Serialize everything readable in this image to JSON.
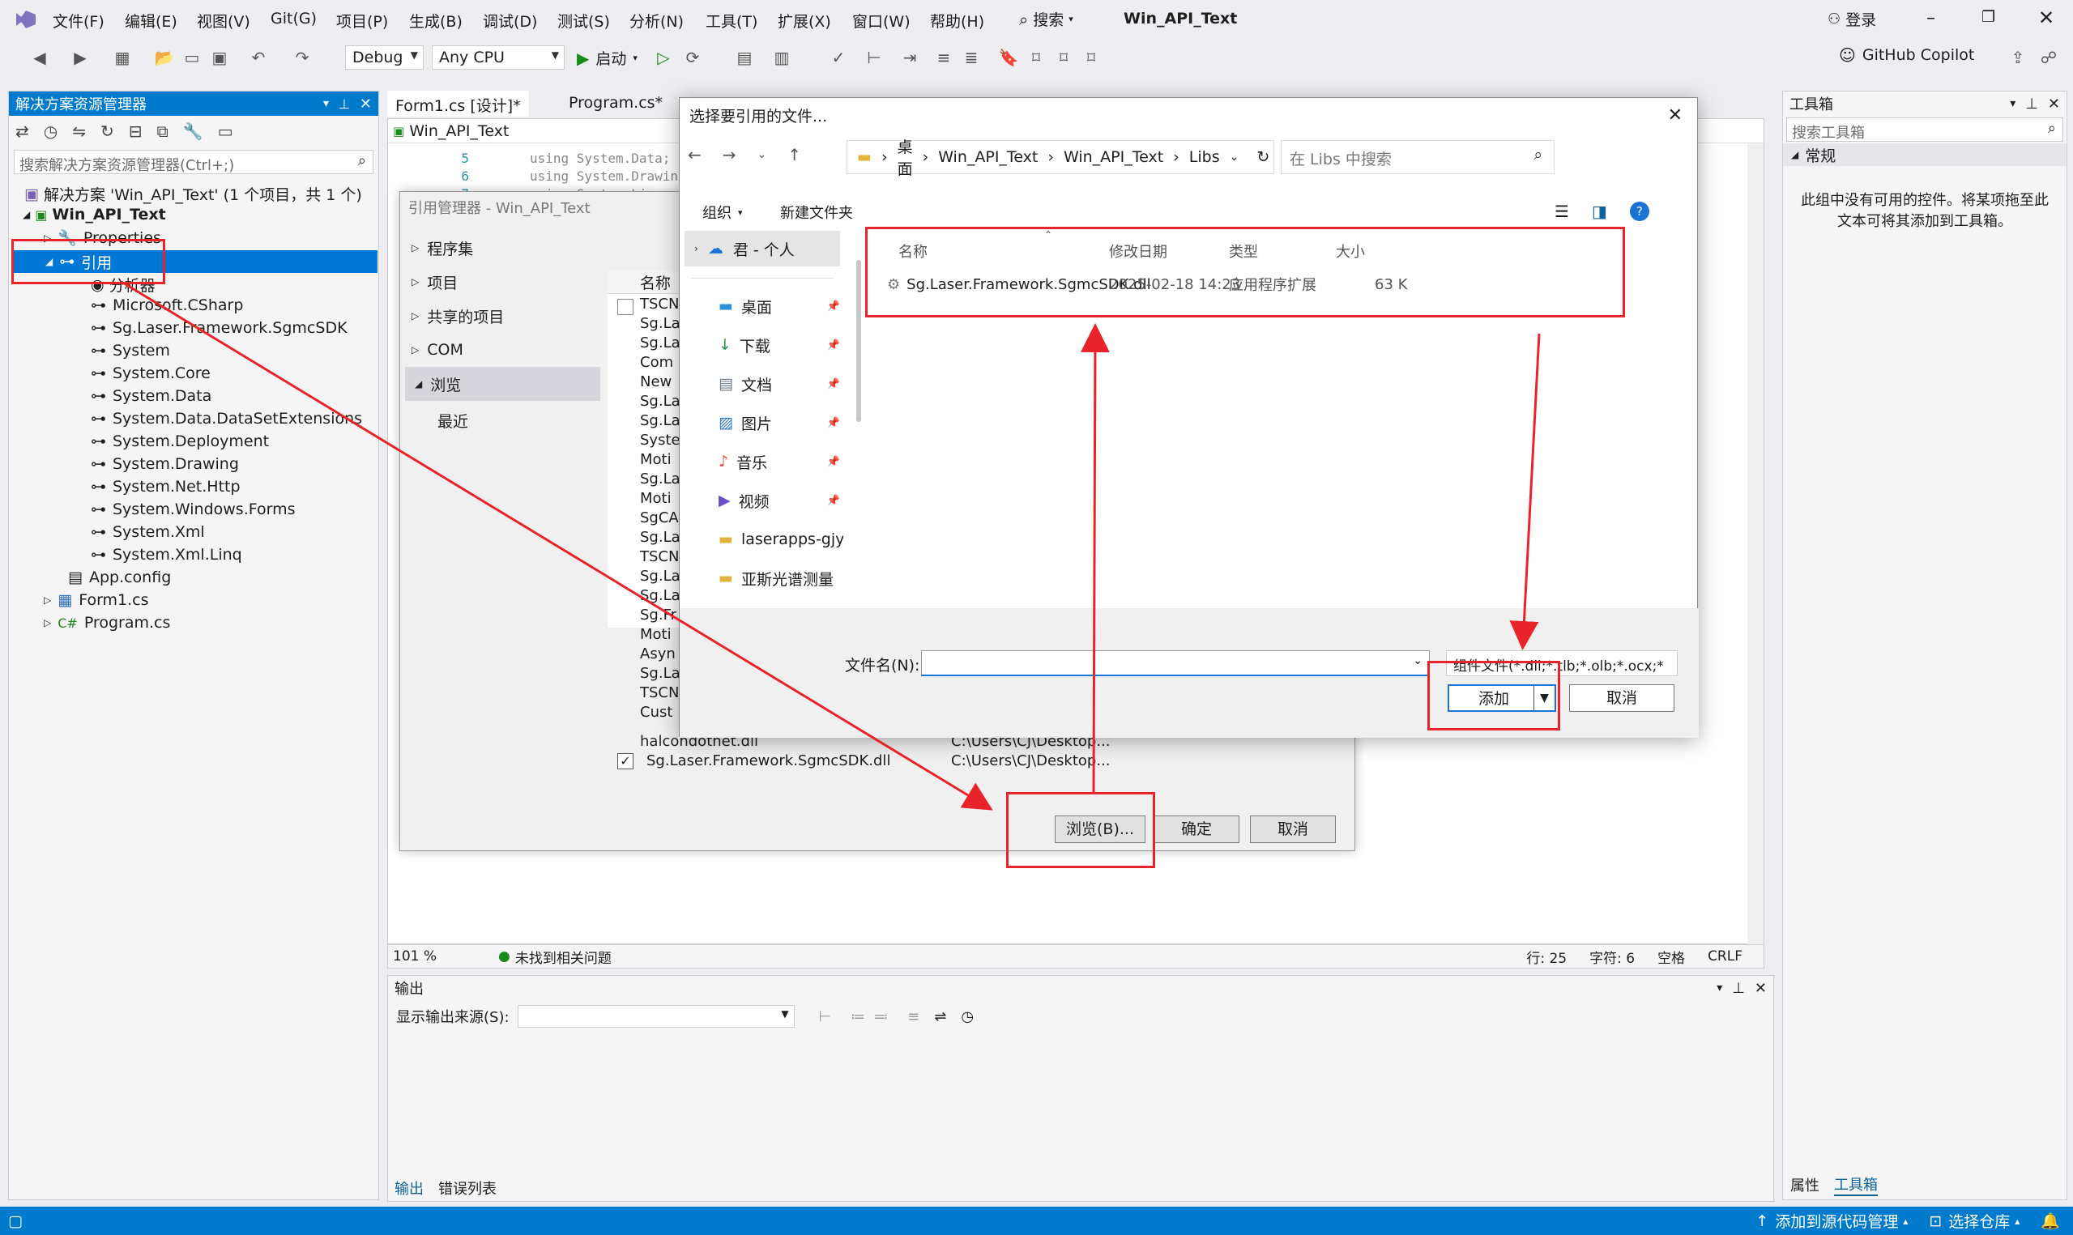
{
  "menubar": {
    "items": [
      "文件(F)",
      "编辑(E)",
      "视图(V)",
      "Git(G)",
      "项目(P)",
      "生成(B)",
      "调试(D)",
      "测试(S)",
      "分析(N)",
      "工具(T)",
      "扩展(X)",
      "窗口(W)",
      "帮助(H)"
    ],
    "search": "搜索",
    "solution_name": "Win_API_Text",
    "login": "登录",
    "copilot": "GitHub Copilot"
  },
  "toolbar": {
    "config": "Debug",
    "platform": "Any CPU",
    "start": "启动"
  },
  "solution_explorer": {
    "title": "解决方案资源管理器",
    "search_placeholder": "搜索解决方案资源管理器(Ctrl+;)",
    "solution": "解决方案 'Win_API_Text' (1 个项目，共 1 个)",
    "project": "Win_API_Text",
    "properties": "Properties",
    "references": "引用",
    "analyzers": "分析器",
    "refs": [
      "Microsoft.CSharp",
      "Sg.Laser.Framework.SgmcSDK",
      "System",
      "System.Core",
      "System.Data",
      "System.Data.DataSetExtensions",
      "System.Deployment",
      "System.Drawing",
      "System.Net.Http",
      "System.Windows.Forms",
      "System.Xml",
      "System.Xml.Linq"
    ],
    "app_config": "App.config",
    "form1": "Form1.cs",
    "program": "Program.cs"
  },
  "editor": {
    "tabs": [
      "Form1.cs [设计]*",
      "Program.cs*"
    ],
    "nav_combo": "Win_API_Text",
    "line_numbers": [
      "5",
      "6",
      "7"
    ],
    "code_lines": [
      "using System.Data;",
      "using System.Drawin",
      "using System.Linq;"
    ],
    "zoom": "101 %",
    "issues": "未找到相关问题",
    "line": "行: 25",
    "col": "字符: 6",
    "space": "空格",
    "eol": "CRLF"
  },
  "toolbox": {
    "title": "工具箱",
    "search_placeholder": "搜索工具箱",
    "group": "常规",
    "empty_text": "此组中没有可用的控件。将某项拖至此文本可将其添加到工具箱。",
    "tabs": [
      "属性",
      "工具箱"
    ]
  },
  "output": {
    "title": "输出",
    "source_label": "显示输出来源(S):",
    "tabs": [
      "输出",
      "错误列表"
    ]
  },
  "statusbar": {
    "source_control": "添加到源代码管理",
    "repo": "选择仓库"
  },
  "ref_manager": {
    "title": "引用管理器 - Win_API_Text",
    "nav": [
      "程序集",
      "项目",
      "共享的项目",
      "COM",
      "浏览",
      "最近"
    ],
    "col_name": "名称",
    "list": [
      "TSCN",
      "Sg.La",
      "Sg.La",
      "Com",
      "New",
      "Sg.La",
      "Sg.La",
      "Syste",
      "Moti",
      "Sg.La",
      "Moti",
      "SgCA",
      "Sg.La",
      "TSCN",
      "Sg.La",
      "Sg.La",
      "Sg.Fr",
      "Moti",
      "Asyn",
      "Sg.La",
      "TSCN",
      "Cust"
    ],
    "row_halcon": "halcondotnet.dll",
    "row_halcon_path": "C:\\Users\\CJ\\Desktop...",
    "row_sdk": "Sg.Laser.Framework.SgmcSDK.dll",
    "row_sdk_path": "C:\\Users\\CJ\\Desktop...",
    "browse_btn": "浏览(B)...",
    "ok_btn": "确定",
    "cancel_btn": "取消"
  },
  "file_dialog": {
    "title": "选择要引用的文件...",
    "breadcrumb": [
      "桌面",
      "Win_API_Text",
      "Win_API_Text",
      "Libs"
    ],
    "search_placeholder": "在 Libs 中搜索",
    "organize": "组织",
    "new_folder": "新建文件夹",
    "sidebar_onedrive": "君 - 个人",
    "sidebar": [
      "桌面",
      "下载",
      "文档",
      "图片",
      "音乐",
      "视频",
      "laserapps-gjys",
      "亚斯光谱测量"
    ],
    "columns": [
      "名称",
      "修改日期",
      "类型",
      "大小"
    ],
    "file": {
      "name": "Sg.Laser.Framework.SgmcSDK.dll",
      "date": "2025-02-18 14:23",
      "type": "应用程序扩展",
      "size": "63 K"
    },
    "filename_label": "文件名(N):",
    "filter": "组件文件(*.dll;*.tlb;*.olb;*.ocx;*",
    "add_btn": "添加",
    "cancel_btn": "取消"
  },
  "colors": {
    "accent": "#007acc",
    "annotation": "#e8242a"
  }
}
